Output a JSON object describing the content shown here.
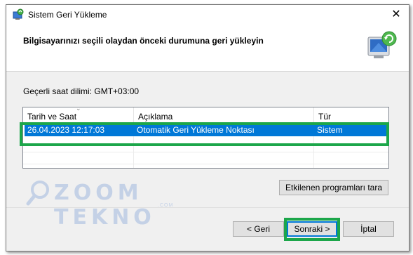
{
  "window": {
    "title": "Sistem Geri Yükleme",
    "close_glyph": "✕",
    "header_title": "Bilgisayarınızı seçili olaydan önceki durumuna geri yükleyin",
    "title_icon": "system-restore-icon",
    "header_icon": "computer-restore-icon"
  },
  "timezone_label": "Geçerli saat dilimi: GMT+03:00",
  "table": {
    "columns": [
      "Tarih ve Saat",
      "Açıklama",
      "Tür"
    ],
    "rows": [
      {
        "date": "26.04.2023 12:17:03",
        "description": "Otomatik Geri Yükleme Noktası",
        "type": "Sistem",
        "selected": true
      }
    ]
  },
  "buttons": {
    "scan": "Etkilenen programları tara",
    "back": "< Geri",
    "next": "Sonraki >",
    "cancel": "İptal"
  },
  "watermark": {
    "text": "ZOOM TEKNO",
    "sub": ".COM"
  },
  "colors": {
    "selection": "#0078d7",
    "highlight": "#1ca64a",
    "watermark": "#c4d1e6"
  }
}
